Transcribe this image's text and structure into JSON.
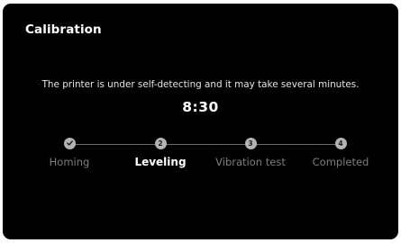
{
  "screen": {
    "title": "Calibration",
    "message": "The printer is under self-detecting and it may take several minutes.",
    "timer": "8:30"
  },
  "steps": [
    {
      "label": "Homing",
      "badge": "",
      "status": "done",
      "icon": "check-icon"
    },
    {
      "label": "Leveling",
      "badge": "2",
      "status": "active"
    },
    {
      "label": "Vibration test",
      "badge": "3",
      "status": "pending"
    },
    {
      "label": "Completed",
      "badge": "4",
      "status": "pending"
    }
  ],
  "colors": {
    "background": "#000000",
    "step_circle": "#b3b3b3",
    "active_label": "#ffffff",
    "inactive_label": "#7d7d7d"
  }
}
